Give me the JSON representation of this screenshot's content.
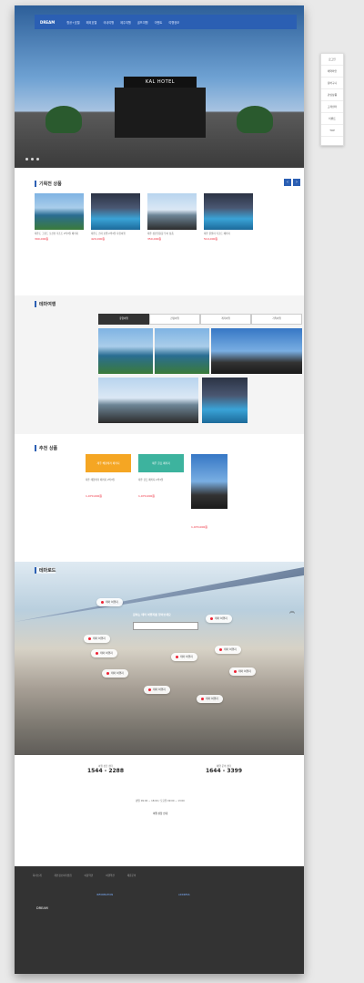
{
  "nav": {
    "logo": "DREAM",
    "items": [
      "항공+호텔",
      "해외호텔",
      "국내여행",
      "제주여행",
      "골프여행",
      "이벤트",
      "여행정보"
    ]
  },
  "hero": {
    "sign": "KAL HOTEL"
  },
  "quick": [
    "로그인",
    "예약확인",
    "장바구니",
    "관심상품",
    "고객센터",
    "이벤트",
    "TOP"
  ],
  "special": {
    "title": "기획전 상품",
    "cards": [
      {
        "desc": "제주도 그랜드 오션뷰 리조트 2박3일 패키지",
        "price": "390,000원"
      },
      {
        "desc": "제주도 스파 호텔 2박3일 자유여행",
        "price": "420,000원"
      },
      {
        "desc": "제주 성산일출봉 투어 상품",
        "price": "350,000원"
      },
      {
        "desc": "제주 풀빌라 리조트 패키지",
        "price": "510,000원"
      }
    ]
  },
  "theme": {
    "title": "테마여행",
    "tabs": [
      "휴양여행",
      "관광여행",
      "레저여행",
      "가족여행"
    ]
  },
  "recommend": {
    "title": "추천 상품",
    "badges": [
      "제주 해양레저 패키지",
      "제주 골프 패키지"
    ],
    "cards": [
      {
        "desc": "제주 해양레저 패키지 2박3일",
        "price": "1,070,000원"
      },
      {
        "desc": "제주 골프 패키지 2박3일",
        "price": "1,070,000원"
      },
      {
        "desc": "",
        "price": "1,070,000원"
      }
    ]
  },
  "road": {
    "title": "테마로드",
    "headline": "원하는 테마 여행지를 찾아보세요",
    "pins": [
      "테마 여행지",
      "테마 여행지",
      "테마 여행지",
      "테마 여행지",
      "테마 여행지",
      "테마 여행지",
      "테마 여행지",
      "테마 여행지",
      "테마 여행지",
      "테마 여행지"
    ]
  },
  "contact": {
    "left": {
      "label": "여행 상담 센터",
      "tel": "1544 - 2288"
    },
    "right": {
      "label": "예약 문의 센터",
      "tel": "1644 - 3399"
    },
    "hours": "평일 09:00 ~ 18:00 / 토요일 09:00 ~ 13:00",
    "guide_title": "여행 상담 안내"
  },
  "footer": {
    "links": [
      "회사소개",
      "개인정보처리방침",
      "이용약관",
      "여행약관",
      "제휴문의"
    ],
    "logo": "DREAM",
    "info_title": "INFORMATION",
    "address_title": "ADDRESS"
  }
}
